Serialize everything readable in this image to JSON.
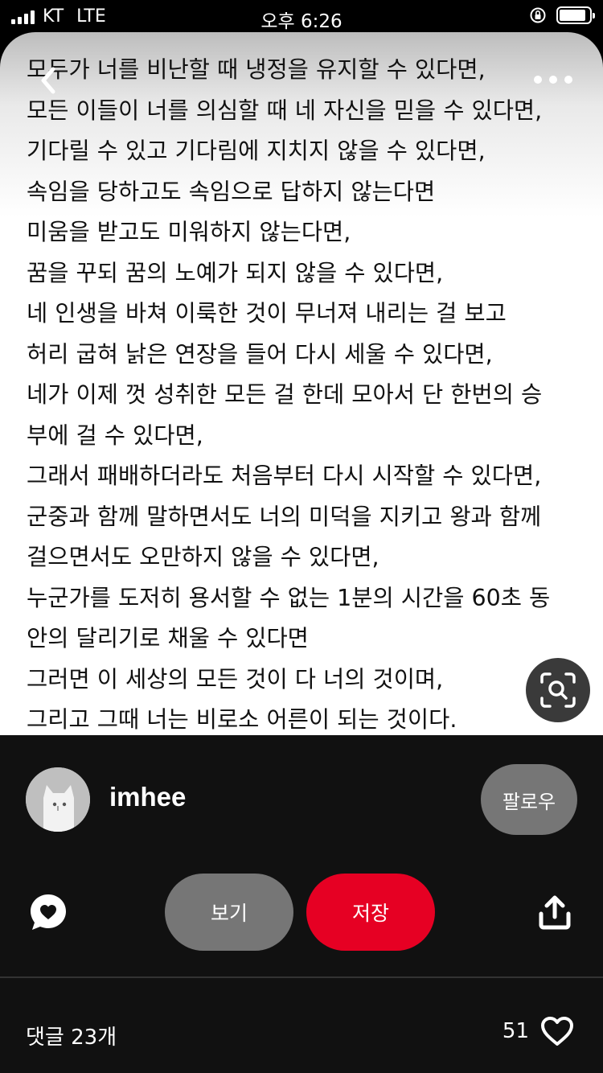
{
  "status_bar": {
    "carrier": "KT",
    "network": "LTE",
    "time": "오후 6:26"
  },
  "pin": {
    "poem_lines": [
      "모두가 너를 비난할 때 냉정을 유지할 수 있다면,",
      "모든 이들이 너를 의심할 때 네 자신을 믿을 수 있다면,",
      "기다릴 수 있고 기다림에 지치지 않을 수 있다면,",
      "속임을 당하고도 속임으로 답하지 않는다면",
      "미움을 받고도 미워하지 않는다면,",
      "꿈을 꾸되 꿈의 노예가 되지 않을 수 있다면,",
      "네 인생을 바쳐 이룩한 것이 무너져 내리는 걸 보고",
      "허리 굽혀 낡은 연장을 들어 다시 세울 수 있다면,",
      "네가 이제 껏 성취한 모든 걸 한데 모아서 단 한번의 승",
      "부에 걸 수 있다면,",
      "그래서 패배하더라도 처음부터 다시 시작할 수 있다면,",
      "군중과 함께 말하면서도 너의 미덕을 지키고 왕과 함께",
      "걸으면서도 오만하지 않을 수 있다면,",
      "누군가를 도저히 용서할 수 없는 1분의 시간을 60초 동",
      "안의 달리기로 채울 수 있다면",
      "그러면 이 세상의 모든 것이 다 너의 것이며,",
      "그리고 그때 너는 비로소 어른이 되는 것이다."
    ]
  },
  "author": {
    "username": "imhee",
    "follow_label": "팔로우"
  },
  "actions": {
    "view_label": "보기",
    "save_label": "저장"
  },
  "footer": {
    "comments_label": "댓글 23개",
    "like_count": "51"
  },
  "colors": {
    "save_button": "#e60023",
    "secondary_button": "#767676",
    "panel_background": "#111111"
  }
}
